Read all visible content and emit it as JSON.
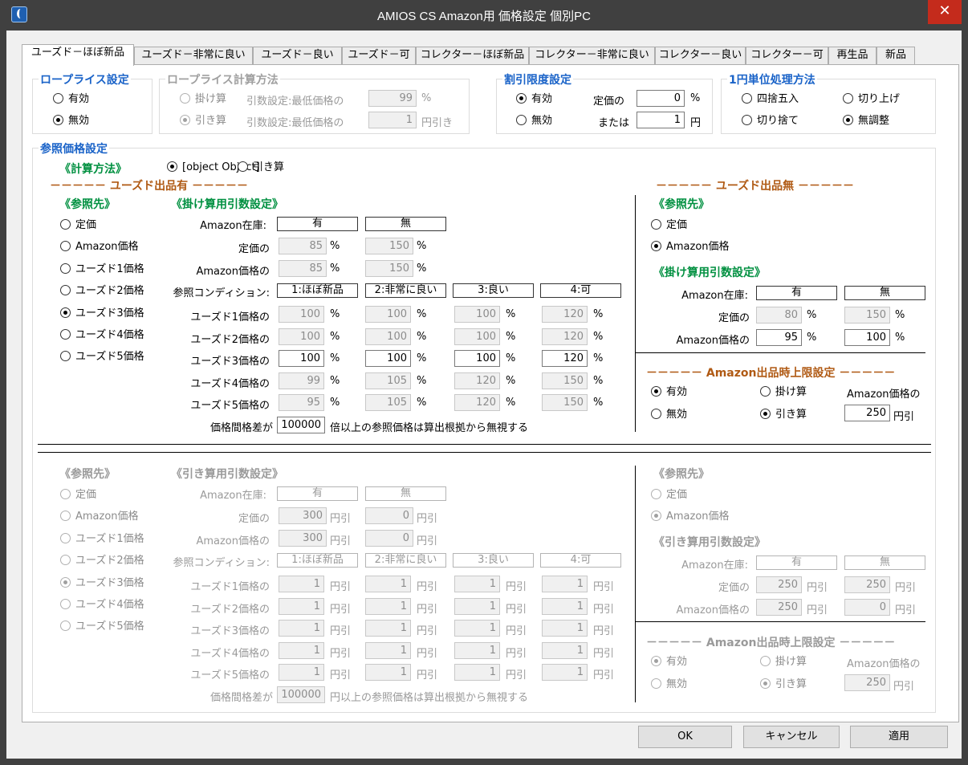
{
  "window": {
    "title": "AMIOS CS Amazon用 価格設定 個別PC",
    "close": "✕"
  },
  "tabs": [
    "ユーズド－ほぼ新品",
    "ユーズド－非常に良い",
    "ユーズド－良い",
    "ユーズド－可",
    "コレクター－ほぼ新品",
    "コレクター－非常に良い",
    "コレクター－良い",
    "コレクター－可",
    "再生品",
    "新品"
  ],
  "lowprice": {
    "title": "ロープライス設定",
    "enabled": "有効",
    "disabled": "無効"
  },
  "lowcalc": {
    "title": "ロープライス計算方法",
    "mul": "掛け算",
    "sub": "引き算",
    "mul_label": "引数設定:最低価格の",
    "mul_value": "99",
    "mul_unit": "%",
    "sub_label": "引数設定:最低価格の",
    "sub_value": "1",
    "sub_unit": "円引き"
  },
  "discount": {
    "title": "割引限度設定",
    "enabled": "有効",
    "disabled": "無効",
    "list_label": "定価の",
    "list_value": "0",
    "list_unit": "%",
    "or_label": "または",
    "yen_value": "1",
    "yen_unit": "円"
  },
  "rounding": {
    "title": "1円単位処理方法",
    "round": "四捨五入",
    "ceil": "切り上げ",
    "floor": "切り捨て",
    "none": "無調整"
  },
  "ref": {
    "title": "参照価格設定",
    "method_label": "《計算方法》",
    "mul": {
      "list": [
        "85",
        "150"
      ],
      "amazon": [
        "85",
        "150"
      ],
      "used": [
        [
          "100",
          "100",
          "100",
          "120"
        ],
        [
          "100",
          "100",
          "100",
          "120"
        ],
        [
          "100",
          "100",
          "100",
          "120"
        ],
        [
          "99",
          "105",
          "120",
          "150"
        ],
        [
          "95",
          "105",
          "120",
          "150"
        ]
      ]
    },
    "sub": "引き算",
    "used_on": "－－－－－ ユーズド出品有 －－－－－",
    "used_off": "－－－－－ ユーズド出品無 －－－－－",
    "source_title": "《参照先》",
    "sources": [
      "定価",
      "Amazon価格",
      "ユーズド1価格",
      "ユーズド2価格",
      "ユーズド3価格",
      "ユーズド4価格",
      "ユーズド5価格"
    ],
    "mul_args_title": "《掛け算用引数設定》",
    "sub_args_title": "《引き算用引数設定》",
    "stock_label": "Amazon在庫:",
    "stock_yes": "有",
    "stock_no": "無",
    "list_row": "定価の",
    "amazon_row": "Amazon価格の",
    "cond_row": "参照コンディション:",
    "conds": [
      "1:ほぼ新品",
      "2:非常に良い",
      "3:良い",
      "4:可"
    ],
    "used_rows": [
      "ユーズド1価格の",
      "ユーズド2価格の",
      "ユーズド3価格の",
      "ユーズド4価格の",
      "ユーズド5価格の"
    ],
    "pct": "%",
    "yenoff": "円引",
    "gap_label": "価格間格差が",
    "gap_value": "100000",
    "gap_note_mul": "倍以上の参照価格は算出根拠から無視する",
    "gap_note_sub": "円以上の参照価格は算出根拠から無視する",
    "cap_title": "－－－－－ Amazon出品時上限設定 －－－－－",
    "cap_enabled": "有効",
    "cap_disabled": "無効",
    "cap_mul": "掛け算",
    "cap_sub": "引き算",
    "cap_amazon": "Amazon価格の",
    "cap_unit": "円引",
    "mul_right": {
      "list": [
        "80",
        "150"
      ],
      "amazon": [
        "95",
        "100"
      ],
      "cap_value": "250"
    },
    "sub_vals": {
      "list": [
        "300",
        "0"
      ],
      "amazon": [
        "300",
        "0"
      ],
      "used": "1"
    },
    "sub_right": {
      "list": [
        "250",
        "250"
      ],
      "amazon": [
        "250",
        "0"
      ],
      "cap_value": "250"
    }
  },
  "buttons": {
    "ok": "OK",
    "cancel": "キャンセル",
    "apply": "適用"
  }
}
